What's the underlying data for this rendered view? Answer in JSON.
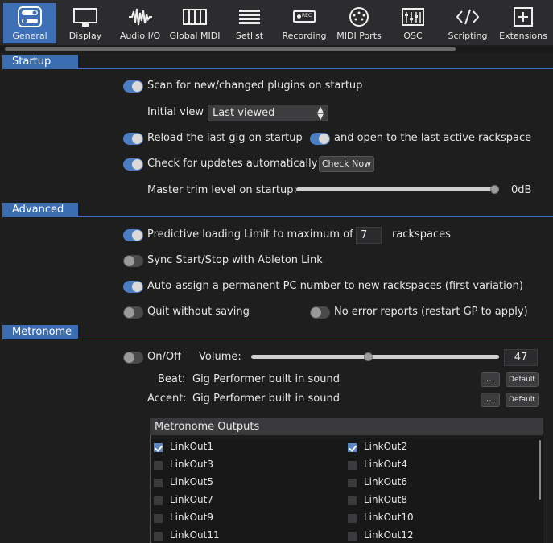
{
  "toolbar": {
    "items": [
      {
        "label": "General",
        "icon": "general-toggles-icon"
      },
      {
        "label": "Display",
        "icon": "monitor-icon"
      },
      {
        "label": "Audio I/O",
        "icon": "waveform-icon"
      },
      {
        "label": "Global MIDI",
        "icon": "piano-keys-icon"
      },
      {
        "label": "Setlist",
        "icon": "list-icon"
      },
      {
        "label": "Recording",
        "icon": "rec-icon"
      },
      {
        "label": "MIDI Ports",
        "icon": "midi-din-icon"
      },
      {
        "label": "OSC",
        "icon": "osc-sliders-icon"
      },
      {
        "label": "Scripting",
        "icon": "code-brackets-icon"
      },
      {
        "label": "Extensions",
        "icon": "plus-box-icon"
      }
    ],
    "rec_badge": "REC"
  },
  "startup": {
    "header": "Startup",
    "scan_plugins": "Scan for new/changed plugins on startup",
    "initial_view_label": "Initial view",
    "initial_view_value": "Last viewed",
    "reload_gig": "Reload the last gig on startup",
    "open_last_rackspace": "and open to the last active rackspace",
    "check_updates": "Check for updates automatically",
    "check_now": "Check Now",
    "master_trim_label": "Master trim level on startup:",
    "master_trim_value": "0dB",
    "master_trim_level": 1.0
  },
  "advanced": {
    "header": "Advanced",
    "predictive_loading": "Predictive loading",
    "limit_label": "Limit to maximum of",
    "limit_value": "7",
    "rackspaces": "rackspaces",
    "sync_ableton": "Sync Start/Stop with Ableton Link",
    "auto_assign_pc": "Auto-assign a permanent PC number to new rackspaces (first variation)",
    "quit_without_saving": "Quit without saving",
    "no_error_reports": "No error reports (restart GP to apply)"
  },
  "metronome": {
    "header": "Metronome",
    "onoff": "On/Off",
    "volume_label": "Volume:",
    "volume_value": "47",
    "volume_level": 0.47,
    "beat_label": "Beat:",
    "beat_value": "Gig Performer built in sound",
    "accent_label": "Accent:",
    "accent_value": "Gig Performer built in sound",
    "browse": "...",
    "default": "Default",
    "outputs_header": "Metronome Outputs",
    "outputs": [
      {
        "label": "LinkOut1",
        "checked": true
      },
      {
        "label": "LinkOut2",
        "checked": true
      },
      {
        "label": "LinkOut3",
        "checked": false
      },
      {
        "label": "LinkOut4",
        "checked": false
      },
      {
        "label": "LinkOut5",
        "checked": false
      },
      {
        "label": "LinkOut6",
        "checked": false
      },
      {
        "label": "LinkOut7",
        "checked": false
      },
      {
        "label": "LinkOut8",
        "checked": false
      },
      {
        "label": "LinkOut9",
        "checked": false
      },
      {
        "label": "LinkOut10",
        "checked": false
      },
      {
        "label": "LinkOut11",
        "checked": false
      },
      {
        "label": "LinkOut12",
        "checked": false
      }
    ]
  },
  "colors": {
    "accent": "#3b6db3",
    "toggle_on": "#4c7ec4",
    "toggle_off": "#4a4a4c",
    "background": "#1e1e1f"
  }
}
